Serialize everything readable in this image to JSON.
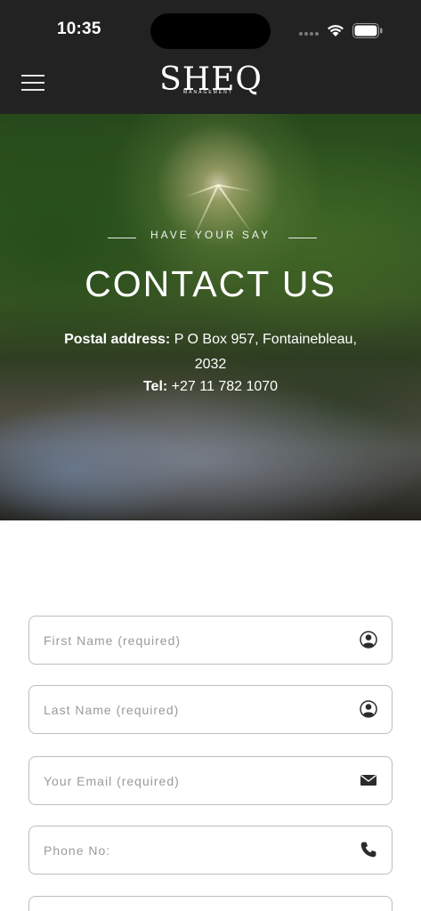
{
  "status_bar": {
    "time": "10:35"
  },
  "header": {
    "logo_text": "SHEQ",
    "logo_subtext": "MANAGEMENT"
  },
  "hero": {
    "eyebrow": "HAVE YOUR SAY",
    "title": "CONTACT US",
    "address_label": "Postal address:",
    "address_value": "P O Box 957, Fontainebleau, 2032",
    "phone_label": "Tel:",
    "phone_value": "+27 11 782 1070"
  },
  "form": {
    "first_name_placeholder": "First Name (required)",
    "last_name_placeholder": "Last Name (required)",
    "email_placeholder": "Your Email (required)",
    "phone_placeholder": "Phone No:"
  },
  "icons": {
    "first_name": "user-icon",
    "last_name": "user-icon",
    "email": "envelope-icon",
    "phone": "phone-icon"
  },
  "colors": {
    "header_bg": "#222222",
    "field_border": "#bdbdbd",
    "placeholder": "#9a9a9a"
  }
}
